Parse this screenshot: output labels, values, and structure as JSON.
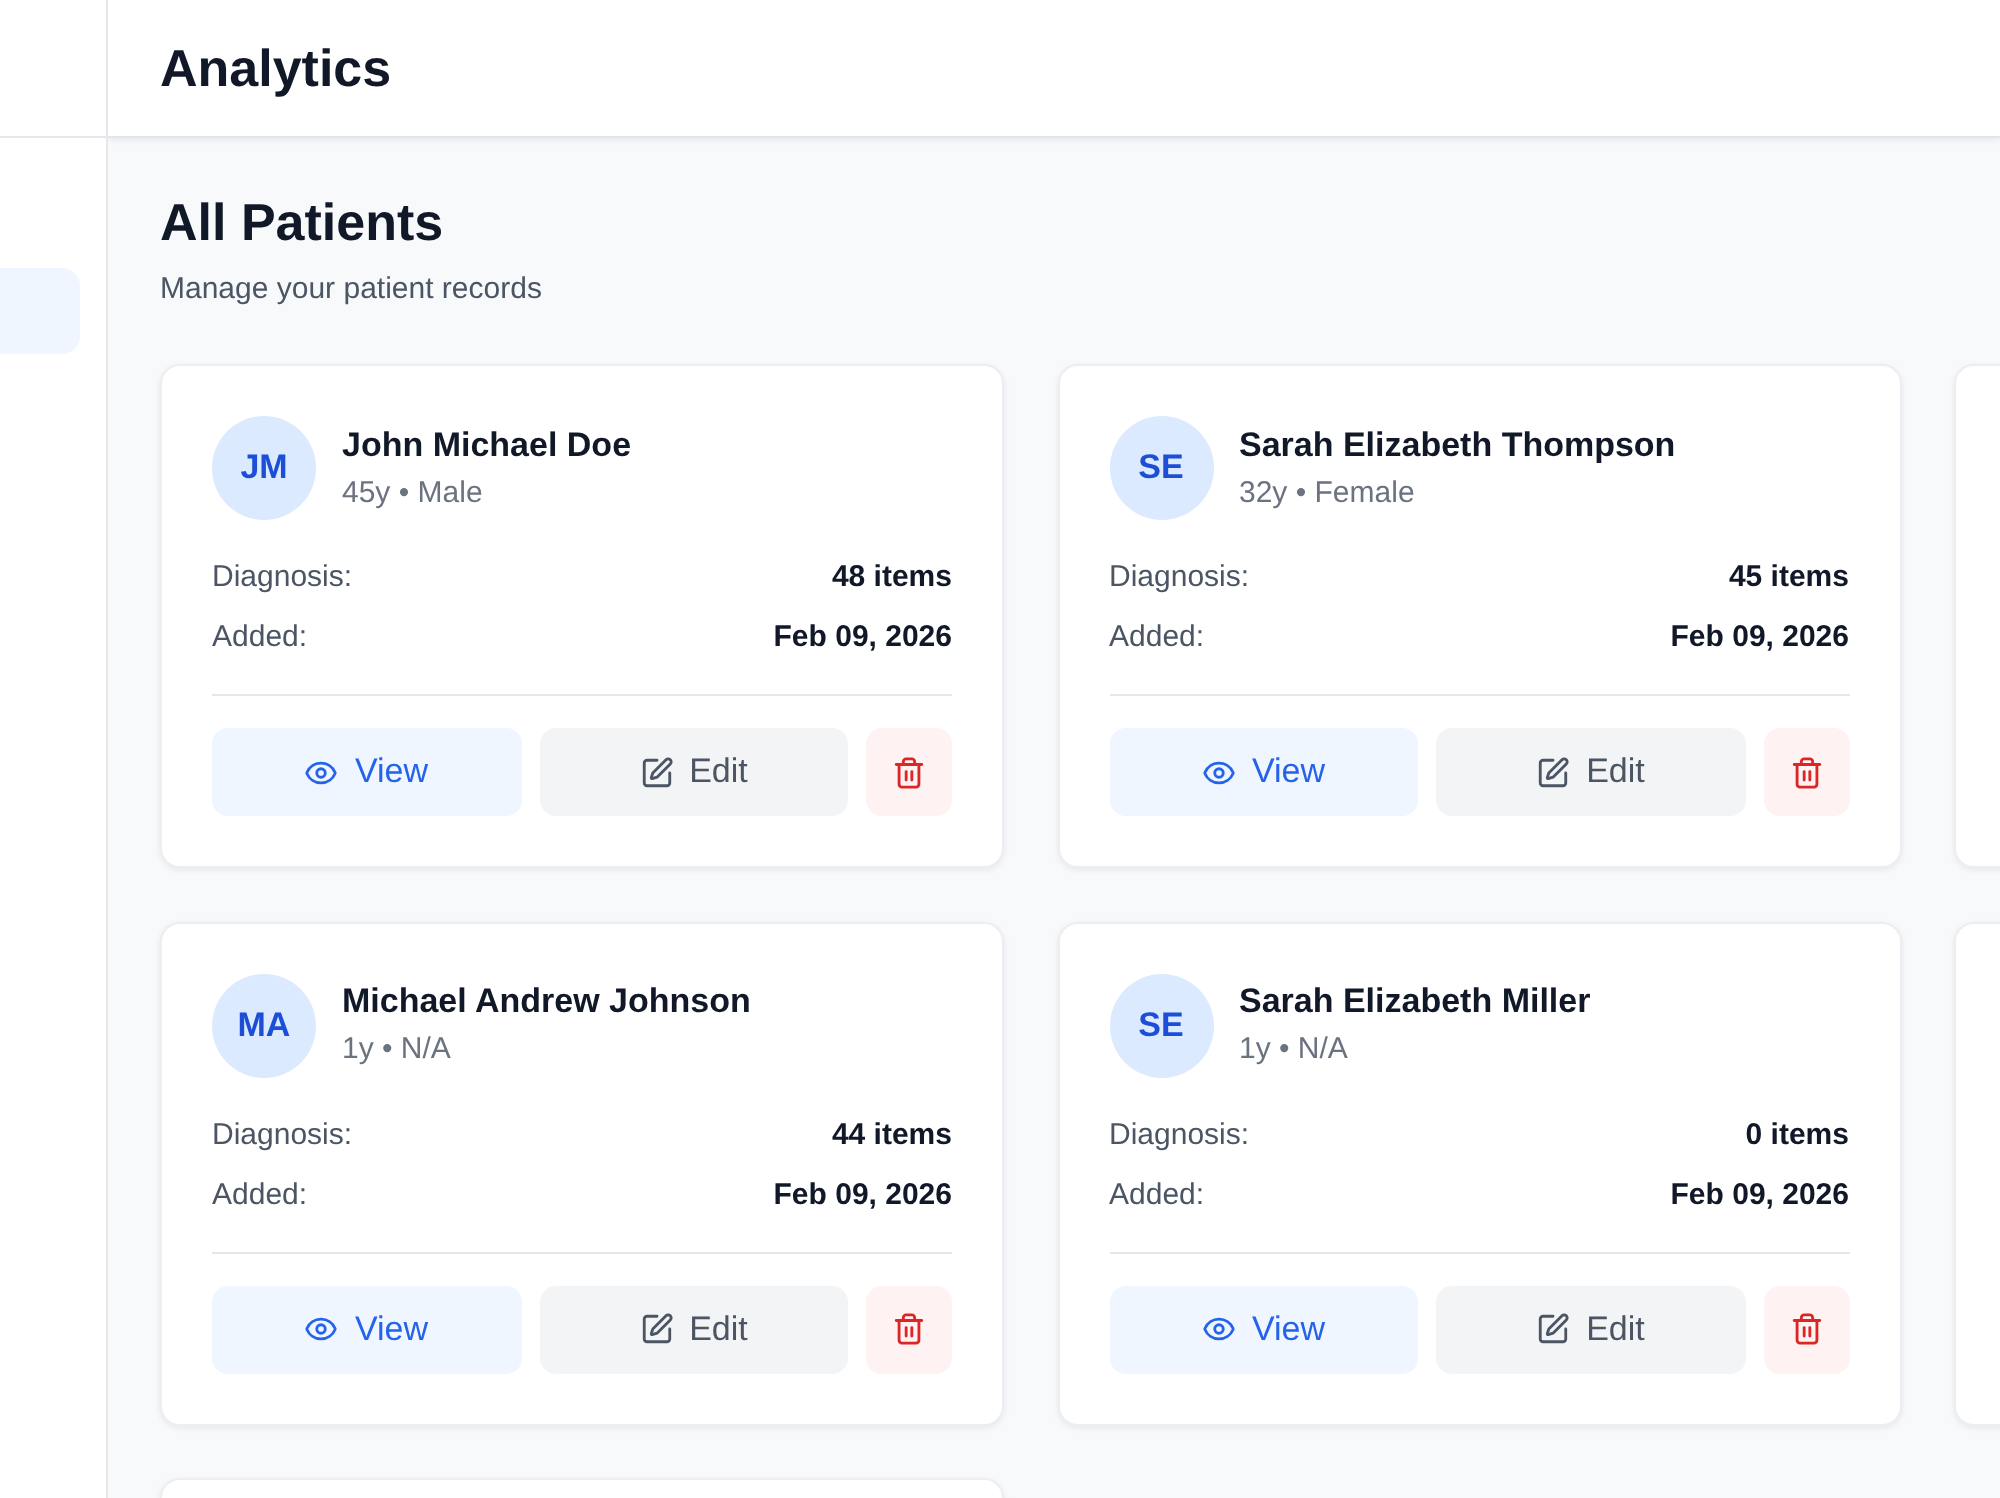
{
  "sidebar": {
    "items": [
      {
        "selected": true
      }
    ]
  },
  "header": {
    "title": "Analytics"
  },
  "page": {
    "title": "All Patients",
    "subtitle": "Manage your patient records"
  },
  "cards": [
    {
      "kind": "patient",
      "initials": "JM",
      "name": "John Michael Doe",
      "meta": "45y • Male",
      "fields": [
        {
          "label": "Diagnosis:",
          "value": "48 items"
        },
        {
          "label": "Added:",
          "value": "Feb 09, 2026"
        }
      ],
      "actions": [
        {
          "kind": "view",
          "label": "View"
        },
        {
          "kind": "edit",
          "label": "Edit"
        },
        {
          "kind": "delete"
        }
      ]
    },
    {
      "kind": "patient",
      "initials": "SE",
      "name": "Sarah Elizabeth Thompson",
      "meta": "32y • Female",
      "fields": [
        {
          "label": "Diagnosis:",
          "value": "45 items"
        },
        {
          "label": "Added:",
          "value": "Feb 09, 2026"
        }
      ],
      "actions": [
        {
          "kind": "view",
          "label": "View"
        },
        {
          "kind": "edit",
          "label": "Edit"
        },
        {
          "kind": "delete"
        }
      ]
    },
    {
      "kind": "clipped"
    },
    {
      "kind": "patient",
      "initials": "MA",
      "name": "Michael Andrew Johnson",
      "meta": "1y • N/A",
      "fields": [
        {
          "label": "Diagnosis:",
          "value": "44 items"
        },
        {
          "label": "Added:",
          "value": "Feb 09, 2026"
        }
      ],
      "actions": [
        {
          "kind": "view",
          "label": "View"
        },
        {
          "kind": "edit",
          "label": "Edit"
        },
        {
          "kind": "delete"
        }
      ]
    },
    {
      "kind": "patient",
      "initials": "SE",
      "name": "Sarah Elizabeth Miller",
      "meta": "1y • N/A",
      "fields": [
        {
          "label": "Diagnosis:",
          "value": "0 items"
        },
        {
          "label": "Added:",
          "value": "Feb 09, 2026"
        }
      ],
      "actions": [
        {
          "kind": "view",
          "label": "View"
        },
        {
          "kind": "edit",
          "label": "Edit"
        },
        {
          "kind": "delete"
        }
      ]
    },
    {
      "kind": "clipped"
    },
    {
      "kind": "clipped"
    }
  ]
}
